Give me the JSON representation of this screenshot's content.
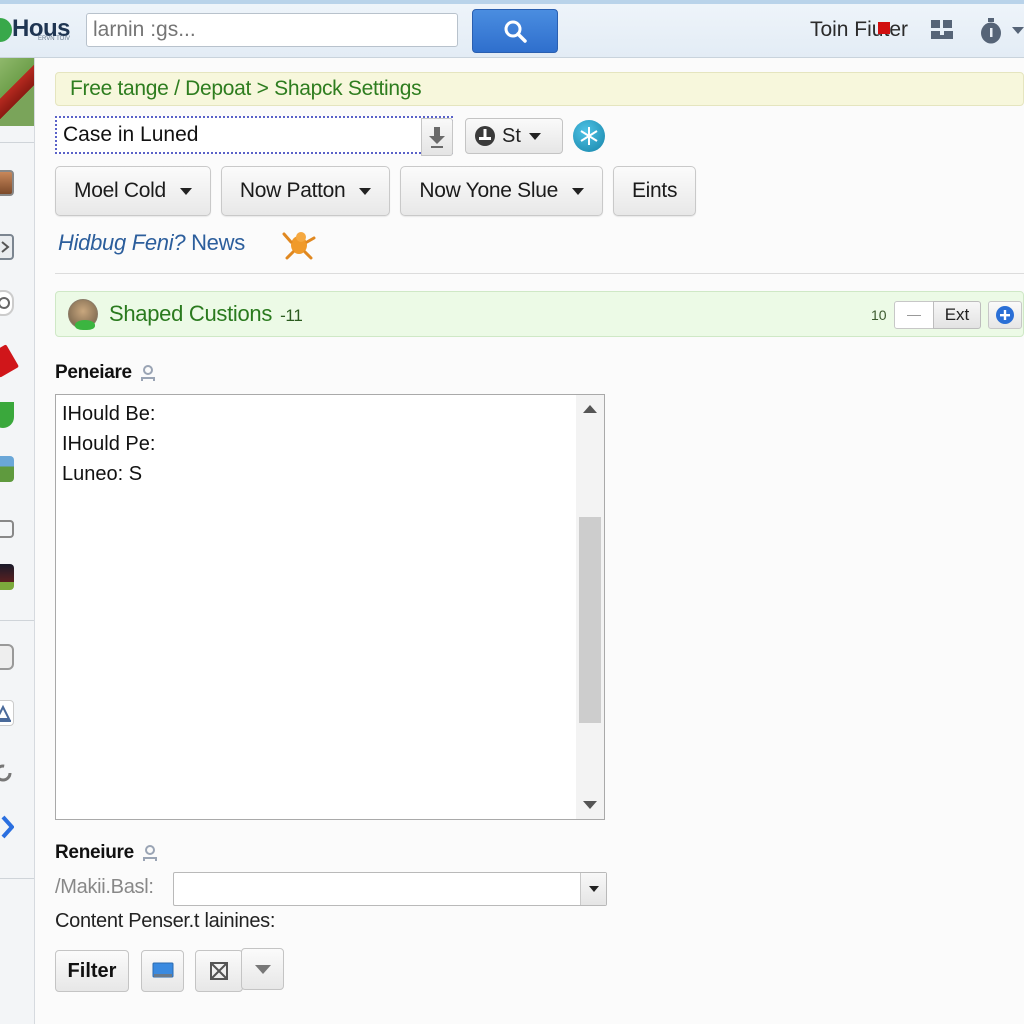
{
  "header": {
    "logo_text": "Hous",
    "logo_subtext": "ERVN TOIV",
    "search_placeholder": "larnin :gs...",
    "search_icon": "search-icon",
    "link_label": "Toin Fiuter",
    "grid_icon": "apps-grid-icon",
    "timer_icon": "stopwatch-icon",
    "menu_icon": "chevron-down-icon"
  },
  "sidebar": {
    "items": [
      {
        "icon": "user-photo-icon"
      },
      {
        "icon": "tag-icon"
      },
      {
        "icon": "location-pin-icon"
      },
      {
        "icon": "red-flag-icon"
      },
      {
        "icon": "green-shield-icon"
      },
      {
        "icon": "landscape-image-icon"
      },
      {
        "icon": "chat-bubble-icon"
      },
      {
        "icon": "night-photo-icon"
      },
      {
        "icon": "printer-icon"
      },
      {
        "icon": "bell-icon"
      },
      {
        "icon": "refresh-icon"
      },
      {
        "icon": "blue-diamond-icon"
      }
    ]
  },
  "breadcrumb": {
    "text": "Free tange / Depoat > Shapck Settings"
  },
  "combo": {
    "value": "Case in Luned",
    "download_icon": "download-arrow-icon"
  },
  "status_button": {
    "label": "St",
    "icon": "stamp-icon"
  },
  "snowflake_icon": "snowflake-icon",
  "toolbar_buttons": [
    {
      "label": "Moel Cold",
      "has_dropdown": true
    },
    {
      "label": "Now Patton",
      "has_dropdown": true
    },
    {
      "label": "Now Yone Slue",
      "has_dropdown": true
    },
    {
      "label": "Eints",
      "has_dropdown": false
    }
  ],
  "news_link": {
    "italic_part": "Hidbug Feni?",
    "plain_part": "News",
    "mascot_icon": "mascot-icon"
  },
  "panel": {
    "title": "Shaped Custions",
    "count": "-11",
    "page_size": "10",
    "minus_label": "—",
    "ext_label": "Ext",
    "add_icon": "plus-circle-icon"
  },
  "field1": {
    "label": "Peneiare",
    "lines": [
      "IHould Be:",
      "IHould Pe:",
      "Luneo: S"
    ]
  },
  "field2": {
    "label": "Reneiure",
    "select_label": "/Makii.Basl:",
    "select_value": "",
    "content_label": "Content Penser.t lainines:"
  },
  "actions": {
    "filter_label": "Filter",
    "monitor_icon": "monitor-icon",
    "clear_icon": "clear-box-icon",
    "more_icon": "dropdown-caret-icon"
  },
  "colors": {
    "breadcrumb_bg": "#f7f7dc",
    "breadcrumb_text": "#2e7d1f",
    "panel_bg": "#ecfae6",
    "accent_blue": "#2f6fcd",
    "link_blue": "#2c5e9c"
  }
}
